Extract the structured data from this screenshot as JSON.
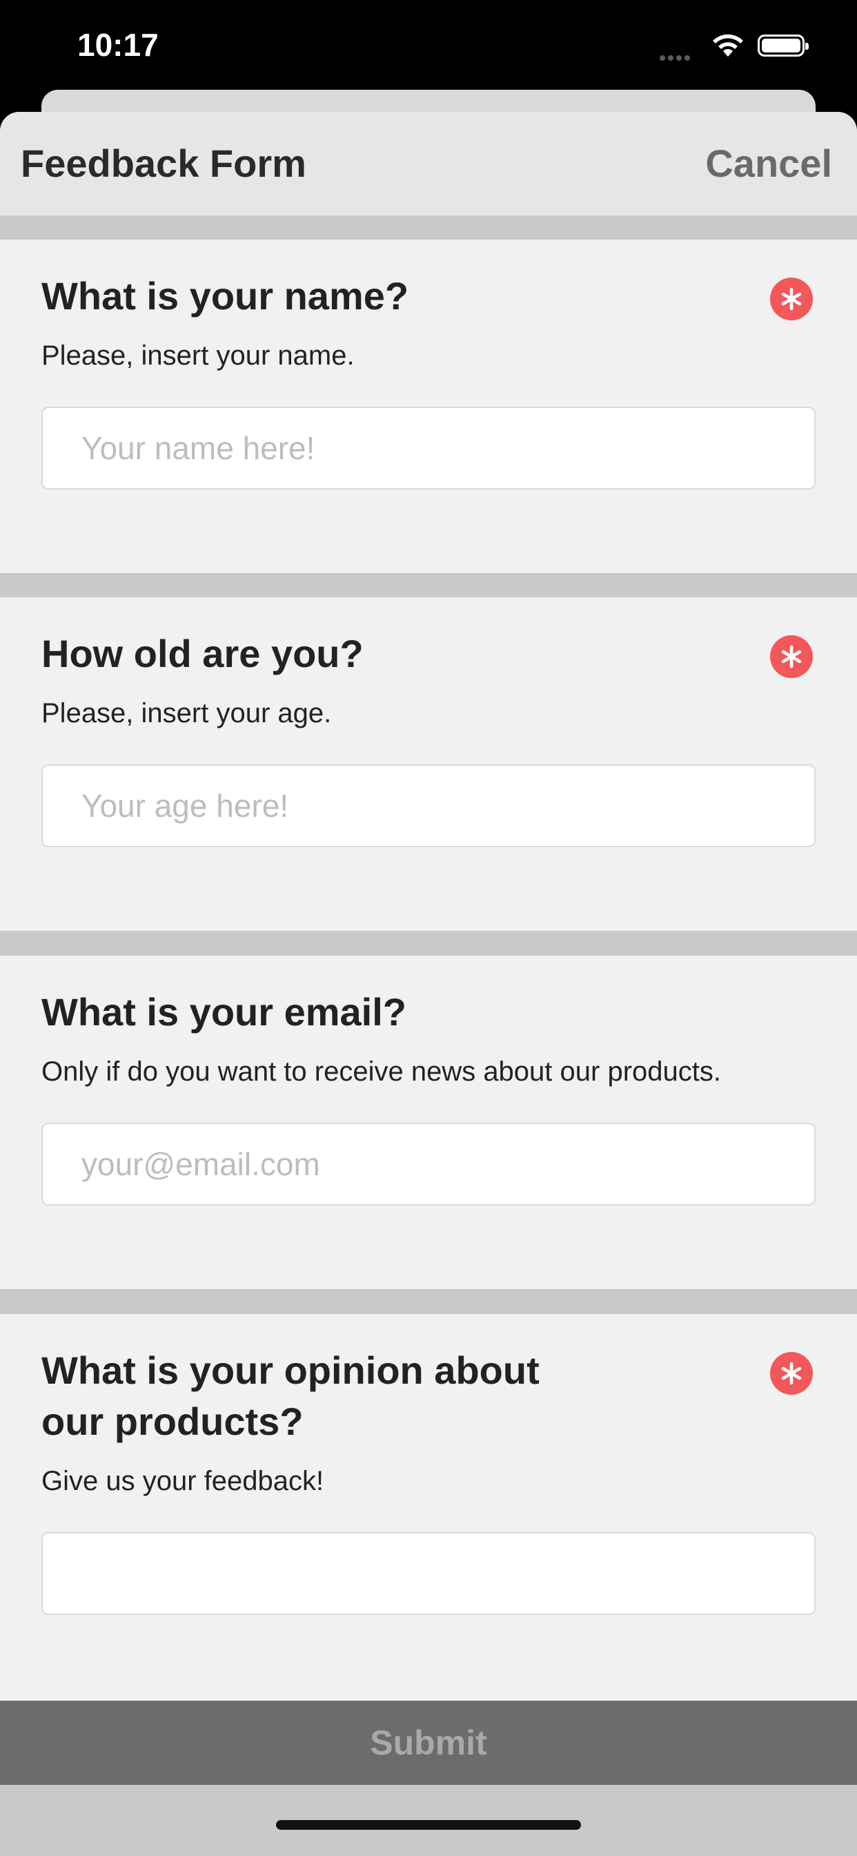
{
  "status_bar": {
    "time": "10:17"
  },
  "nav": {
    "title": "Feedback Form",
    "cancel_label": "Cancel"
  },
  "questions": [
    {
      "title": "What is your name?",
      "description": "Please, insert your name.",
      "placeholder": "Your name here!",
      "value": "",
      "required": true
    },
    {
      "title": "How old are you?",
      "description": "Please, insert your age.",
      "placeholder": "Your age here!",
      "value": "",
      "required": true
    },
    {
      "title": "What is your email?",
      "description": "Only if do you want to receive news about our products.",
      "placeholder": "your@email.com",
      "value": "",
      "required": false
    },
    {
      "title_line1": "What is your opinion about",
      "title_line2": "our products?",
      "description": "Give us your feedback!",
      "placeholder": "",
      "value": "",
      "required": true
    }
  ],
  "submit": {
    "label": "Submit",
    "enabled": false
  },
  "colors": {
    "required_badge": "#f2585a",
    "submit_bar": "#6c6c6c",
    "nav_bar": "#e6e6e6",
    "section_bg": "#f1f1f1",
    "separator": "#c9c9c9"
  }
}
